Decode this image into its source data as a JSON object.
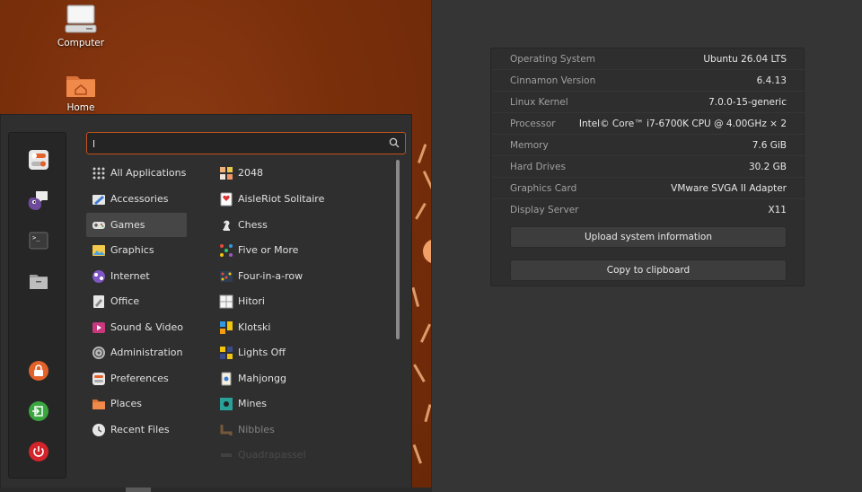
{
  "desktop": {
    "icons": [
      {
        "label": "Computer",
        "icon": "computer-icon"
      },
      {
        "label": "Home",
        "icon": "home-folder-icon"
      }
    ]
  },
  "menu": {
    "search": {
      "value": "l",
      "placeholder": ""
    },
    "favorites": [
      {
        "icon": "settings-toggle-icon"
      },
      {
        "icon": "pidgin-chat-icon"
      },
      {
        "icon": "terminal-icon"
      },
      {
        "icon": "folder-icon"
      },
      {
        "icon": "lock-screen-icon"
      },
      {
        "icon": "logout-icon"
      },
      {
        "icon": "power-icon"
      }
    ],
    "categories": [
      {
        "label": "All Applications",
        "icon": "all-apps-icon"
      },
      {
        "label": "Accessories",
        "icon": "accessories-icon"
      },
      {
        "label": "Games",
        "icon": "games-icon",
        "selected": true
      },
      {
        "label": "Graphics",
        "icon": "graphics-icon"
      },
      {
        "label": "Internet",
        "icon": "internet-icon"
      },
      {
        "label": "Office",
        "icon": "office-icon"
      },
      {
        "label": "Sound & Video",
        "icon": "sound-video-icon"
      },
      {
        "label": "Administration",
        "icon": "administration-icon"
      },
      {
        "label": "Preferences",
        "icon": "preferences-icon"
      },
      {
        "label": "Places",
        "icon": "places-icon"
      },
      {
        "label": "Recent Files",
        "icon": "recent-files-icon"
      }
    ],
    "apps": [
      {
        "label": "2048",
        "icon": "game-2048-icon"
      },
      {
        "label": "AisleRiot Solitaire",
        "icon": "solitaire-icon"
      },
      {
        "label": "Chess",
        "icon": "chess-icon"
      },
      {
        "label": "Five or More",
        "icon": "five-or-more-icon"
      },
      {
        "label": "Four-in-a-row",
        "icon": "four-in-a-row-icon"
      },
      {
        "label": "Hitori",
        "icon": "hitori-icon"
      },
      {
        "label": "Klotski",
        "icon": "klotski-icon"
      },
      {
        "label": "Lights Off",
        "icon": "lights-off-icon"
      },
      {
        "label": "Mahjongg",
        "icon": "mahjongg-icon"
      },
      {
        "label": "Mines",
        "icon": "mines-icon"
      },
      {
        "label": "Nibbles",
        "icon": "nibbles-icon",
        "faded": true
      },
      {
        "label": "Quadrapassel",
        "icon": "quadrapassel-icon",
        "ghost": true
      }
    ]
  },
  "sysinfo": {
    "rows": [
      {
        "key": "Operating System",
        "value": "Ubuntu 26.04 LTS"
      },
      {
        "key": "Cinnamon Version",
        "value": "6.4.13"
      },
      {
        "key": "Linux Kernel",
        "value": "7.0.0-15-generic"
      },
      {
        "key": "Processor",
        "value": "Intel© Core™ i7-6700K CPU @ 4.00GHz × 2"
      },
      {
        "key": "Memory",
        "value": "7.6 GiB"
      },
      {
        "key": "Hard Drives",
        "value": "30.2 GB"
      },
      {
        "key": "Graphics Card",
        "value": "VMware SVGA II Adapter"
      },
      {
        "key": "Display Server",
        "value": "X11"
      }
    ],
    "upload_label": "Upload system information",
    "copy_label": "Copy to clipboard"
  },
  "colors": {
    "accent": "#c4541c",
    "wallpaper": "#7a2e0c",
    "window_bg": "#353535",
    "menu_bg": "#2f2f2f"
  }
}
